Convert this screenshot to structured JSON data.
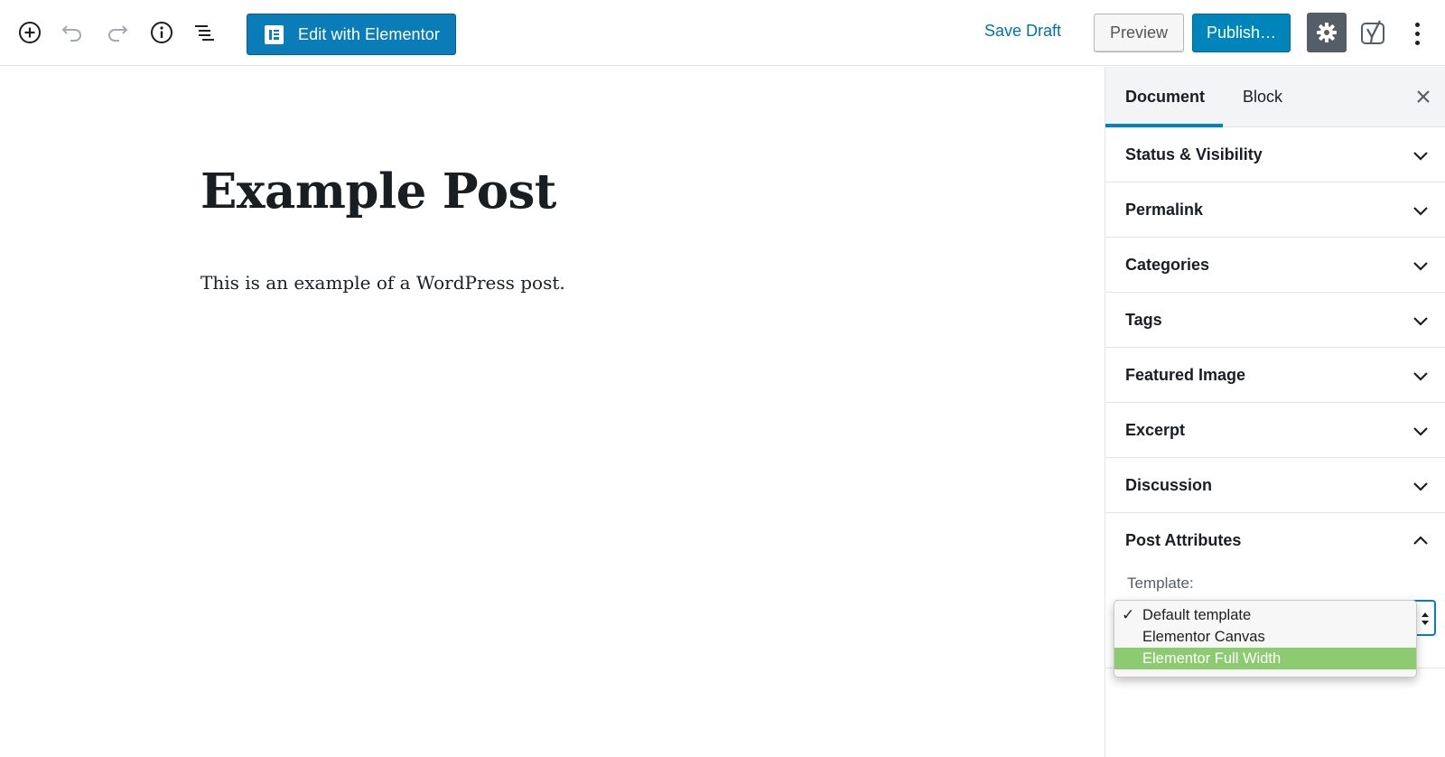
{
  "toolbar": {
    "elementor_label": "Edit with Elementor",
    "save_draft": "Save Draft",
    "preview": "Preview",
    "publish": "Publish…"
  },
  "post": {
    "title": "Example Post",
    "body": "This is an example of a WordPress post."
  },
  "sidebar": {
    "tabs": [
      {
        "label": "Document",
        "active": true
      },
      {
        "label": "Block",
        "active": false
      }
    ],
    "panels": [
      {
        "label": "Status & Visibility",
        "expanded": false
      },
      {
        "label": "Permalink",
        "expanded": false
      },
      {
        "label": "Categories",
        "expanded": false
      },
      {
        "label": "Tags",
        "expanded": false
      },
      {
        "label": "Featured Image",
        "expanded": false
      },
      {
        "label": "Excerpt",
        "expanded": false
      },
      {
        "label": "Discussion",
        "expanded": false
      },
      {
        "label": "Post Attributes",
        "expanded": true
      }
    ],
    "post_attributes": {
      "template_label": "Template:",
      "options": [
        {
          "label": "Default template",
          "checked": true,
          "highlighted": false
        },
        {
          "label": "Elementor Canvas",
          "checked": false,
          "highlighted": false
        },
        {
          "label": "Elementor Full Width",
          "checked": false,
          "highlighted": true
        }
      ]
    }
  },
  "colors": {
    "primary_blue": "#0085ba",
    "link_blue": "#0073aa",
    "elementor_blue": "#0a7db8",
    "settings_bg": "#555d66",
    "highlight_green": "#8ccb70"
  },
  "icons": {
    "add_block": "plus-circle-icon",
    "undo": "undo-icon",
    "redo": "redo-icon",
    "info": "info-icon",
    "outline": "list-outline-icon",
    "settings": "gear-icon",
    "yoast": "yoast-icon",
    "more": "more-vertical-icon",
    "close": "close-icon",
    "chevron": "chevron-icon"
  }
}
